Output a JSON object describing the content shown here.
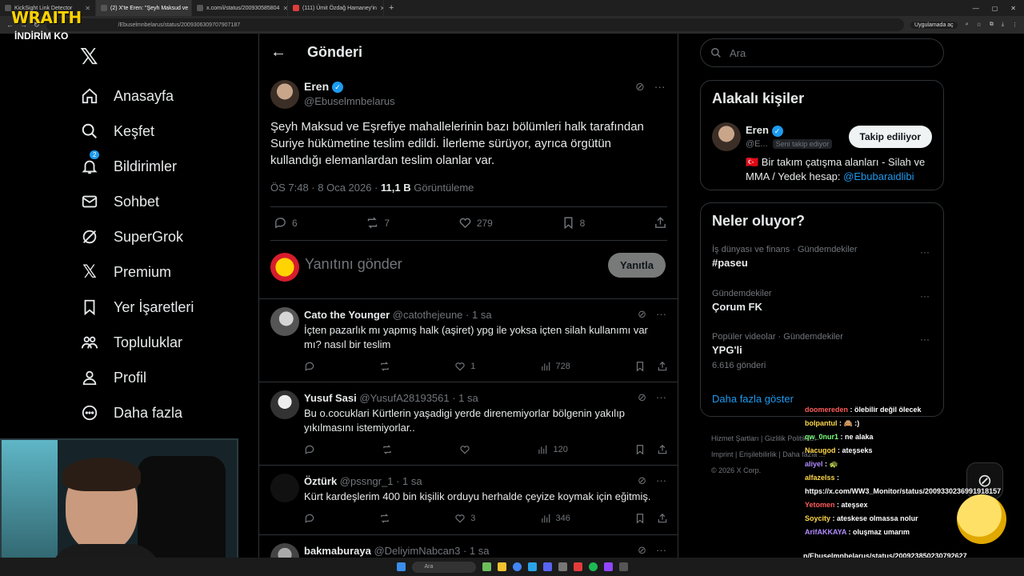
{
  "browser": {
    "tabs": [
      {
        "title": "KickSight Link Detector",
        "active": false
      },
      {
        "title": "(2) X'te Eren: \"Şeyh Maksud ve",
        "active": true
      },
      {
        "title": "x.com/i/status/200930585804",
        "active": false
      },
      {
        "title": "(111) Ümit Özdağ Hamaney'in",
        "active": false
      }
    ],
    "new_tab": "+",
    "url": "/Ebuselmnbelarus/status/2009306309707907187",
    "open_in_app": "Uygulamada aç"
  },
  "overlay": {
    "brand": "WRAITH",
    "promo": "İNDİRİM KO"
  },
  "nav": {
    "items": [
      {
        "label": "Anasayfa",
        "icon": "home-icon"
      },
      {
        "label": "Keşfet",
        "icon": "search-icon"
      },
      {
        "label": "Bildirimler",
        "icon": "bell-icon",
        "badge": "2"
      },
      {
        "label": "Sohbet",
        "icon": "mail-icon"
      },
      {
        "label": "SuperGrok",
        "icon": "grok-icon"
      },
      {
        "label": "Premium",
        "icon": "x-icon"
      },
      {
        "label": "Yer İşaretleri",
        "icon": "bookmark-icon"
      },
      {
        "label": "Topluluklar",
        "icon": "people-icon"
      },
      {
        "label": "Profil",
        "icon": "person-icon"
      },
      {
        "label": "Daha fazla",
        "icon": "more-icon"
      }
    ]
  },
  "header": {
    "title": "Gönderi"
  },
  "tweet": {
    "name": "Eren",
    "handle": "@Ebuselmnbelarus",
    "text": "Şeyh Maksud ve Eşrefiye mahallelerinin bazı bölümleri halk tarafından Suriye hükümetine teslim edildi. İlerleme sürüyor, ayrıca örgütün kullandığı elemanlardan teslim olanlar var.",
    "time": "ÖS 7:48 · 8 Oca 2026 ·",
    "views": "11,1 B",
    "views_label": "Görüntüleme",
    "replies": "6",
    "retweets": "7",
    "likes": "279",
    "bookmarks": "8"
  },
  "composer": {
    "placeholder": "Yanıtını gönder",
    "button": "Yanıtla"
  },
  "replies": [
    {
      "name": "Cato the Younger",
      "handle": "@catothejeune",
      "time": "· 1 sa",
      "text": "İçten pazarlık mı yapmış halk (aşiret) ypg ile yoksa içten silah kullanımı var mı? nasıl bir teslim",
      "replies": "",
      "retweets": "",
      "likes": "1",
      "views": "728"
    },
    {
      "name": "Yusuf Sasi",
      "handle": "@YusufA28193561",
      "time": "· 1 sa",
      "text": "Bu o.cocuklari Kürtlerin yaşadigi yerde direnemiyorlar bölgenin yakılıp yıkılmasını istemiyorlar..",
      "replies": "",
      "retweets": "",
      "likes": "",
      "views": "120"
    },
    {
      "name": "Öztürk",
      "handle": "@pssngr_1",
      "time": "· 1 sa",
      "text": "Kürt kardeşlerim 400 bin kişilik orduyu herhalde çeyize koymak için eğitmiş.",
      "replies": "",
      "retweets": "",
      "likes": "3",
      "views": "346"
    },
    {
      "name": "bakmaburaya",
      "handle": "@DeliyimNabcan3",
      "time": "· 1 sa",
      "text": "",
      "replies": "",
      "retweets": "",
      "likes": "",
      "views": ""
    }
  ],
  "right": {
    "search_placeholder": "Ara",
    "related": {
      "title": "Alakalı kişiler",
      "name": "Eren",
      "handle": "@E...",
      "follows_you": "Seni takip ediyor",
      "follow_button": "Takip ediliyor",
      "bio": "🇹🇷 Bir takım çatışma alanları - Silah ve MMA / Yedek hesap:",
      "bio_link": "@Ebubaraidlibi"
    },
    "trends": {
      "title": "Neler oluyor?",
      "items": [
        {
          "meta": "İş dünyası ve finans · Gündemdekiler",
          "name": "#paseu",
          "count": ""
        },
        {
          "meta": "Gündemdekiler",
          "name": "Çorum FK",
          "count": ""
        },
        {
          "meta": "Popüler videolar · Gündemdekiler",
          "name": "YPG'li",
          "count": "6.616 gönderi"
        }
      ],
      "show_more": "Daha fazla göster"
    },
    "footer": [
      "Hizmet Şartları",
      "Gizlilik",
      "Politikası",
      "Imprint",
      "Erişilebilirlik",
      "Daha fazla ...",
      "© 2026 X Corp."
    ]
  },
  "chat": [
    {
      "user": "doomereden",
      "msg": ": ölebilir değil ölecek",
      "cls": "u1"
    },
    {
      "user": "bolpantul",
      "msg": ": 🙈 :)",
      "cls": "u2"
    },
    {
      "user": "qw_0nur1",
      "msg": ": ne alaka",
      "cls": "u3"
    },
    {
      "user": "Nacugod",
      "msg": ": ateşseks",
      "cls": "u2"
    },
    {
      "user": "aliyel",
      "msg": ": 🐢",
      "cls": "u4"
    },
    {
      "user": "alfazelss",
      "msg": ":",
      "cls": "u2"
    },
    {
      "user": "",
      "msg": "https://x.com/WW3_Monitor/status/2009330236991918157",
      "cls": ""
    },
    {
      "user": "Yetomen",
      "msg": ": ateşsex",
      "cls": "u1"
    },
    {
      "user": "Soycity",
      "msg": ": ateskese olmassa nolur",
      "cls": "u2"
    },
    {
      "user": "ArifAKKAYA",
      "msg": ": oluşmaz umarım",
      "cls": "u4"
    }
  ],
  "overflow_url": "n/Ebuselmnbelarus/status/200923850230792627",
  "taskbar": {
    "search": "Ara"
  }
}
